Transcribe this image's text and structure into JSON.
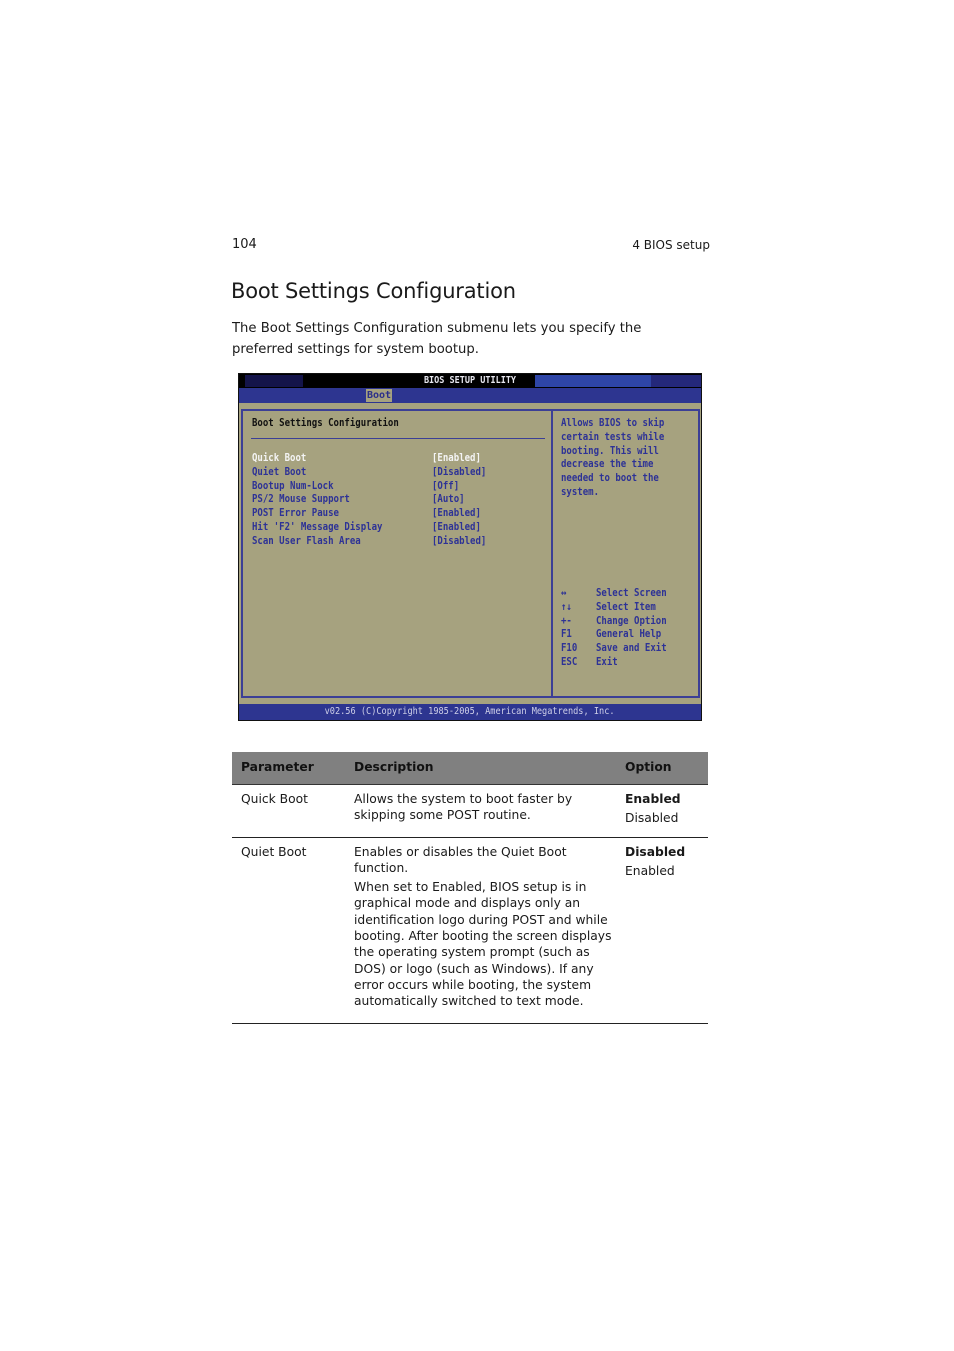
{
  "header": {
    "page_number": "104",
    "chapter": "4 BIOS setup"
  },
  "section": {
    "title": "Boot Settings Configuration",
    "intro": "The Boot Settings Configuration submenu lets you specify the preferred settings for system bootup."
  },
  "bios": {
    "title": "BIOS SETUP UTILITY",
    "active_tab": "Boot",
    "panel_heading": "Boot Settings Configuration",
    "settings": [
      {
        "label": "Quick Boot",
        "value": "[Enabled]",
        "selected": true
      },
      {
        "label": "Quiet Boot",
        "value": "[Disabled]",
        "selected": false
      },
      {
        "label": "Bootup Num-Lock",
        "value": "[Off]",
        "selected": false
      },
      {
        "label": "PS/2 Mouse Support",
        "value": "[Auto]",
        "selected": false
      },
      {
        "label": "POST Error Pause",
        "value": "[Enabled]",
        "selected": false
      },
      {
        "label": "Hit 'F2' Message Display",
        "value": "[Enabled]",
        "selected": false
      },
      {
        "label": "Scan User Flash Area",
        "value": "[Disabled]",
        "selected": false
      }
    ],
    "help_text": "Allows BIOS to skip\ncertain tests while\nbooting. This will\ndecrease the time\nneeded to boot the\nsystem.",
    "keys": [
      {
        "key": "↔",
        "action": "Select Screen"
      },
      {
        "key": "↑↓",
        "action": "Select Item"
      },
      {
        "key": "+-",
        "action": "Change Option"
      },
      {
        "key": "F1",
        "action": "General Help"
      },
      {
        "key": "F10",
        "action": "Save and Exit"
      },
      {
        "key": "ESC",
        "action": "Exit"
      }
    ],
    "footer": "v02.56 (C)Copyright 1985-2005, American Megatrends, Inc.",
    "colors": {
      "background": "#a6a27f",
      "accent_blue": "#2d3590",
      "text_blue": "#2d3296",
      "selected_text": "#f4f4f4"
    }
  },
  "table": {
    "headers": [
      "Parameter",
      "Description",
      "Option"
    ],
    "rows": [
      {
        "parameter": "Quick Boot",
        "description": [
          "Allows the system to boot faster by skipping some POST routine."
        ],
        "default_option": "Enabled",
        "other_option": "Disabled"
      },
      {
        "parameter": "Quiet Boot",
        "description": [
          "Enables or disables the Quiet Boot function.",
          "When set to Enabled, BIOS setup is in graphical mode and displays only an identification logo during POST and while booting. After booting the screen displays the operating system prompt (such as DOS) or logo (such as Windows). If any error occurs while booting, the system automatically switched to text mode."
        ],
        "default_option": "Disabled",
        "other_option": "Enabled"
      }
    ]
  }
}
